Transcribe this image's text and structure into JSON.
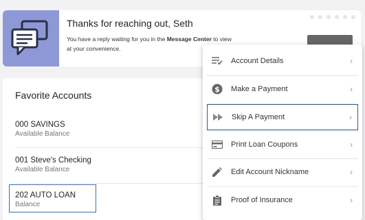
{
  "banner": {
    "title": "Thanks for reaching out, Seth",
    "text_before": "You have a reply waiting for you in the ",
    "text_bold": "Message Center",
    "text_after": " to view at your convenience.",
    "icon": "chat-bubbles-icon",
    "icon_bg_color": "#8f98d6"
  },
  "favorites": {
    "title": "Favorite Accounts",
    "accounts": [
      {
        "name": "000 SAVINGS",
        "sub": "Available Balance"
      },
      {
        "name": "001 Steve's Checking",
        "sub": "Available Balance"
      },
      {
        "name": "202 AUTO LOAN",
        "sub": "Balance"
      }
    ]
  },
  "menu": {
    "items": [
      {
        "label": "Account Details",
        "icon": "list-check-icon"
      },
      {
        "label": "Make a Payment",
        "icon": "dollar-circle-icon"
      },
      {
        "label": "Skip A Payment",
        "icon": "fast-forward-icon"
      },
      {
        "label": "Print Loan Coupons",
        "icon": "card-icon"
      },
      {
        "label": "Edit Account Nickname",
        "icon": "pencil-icon"
      },
      {
        "label": "Proof of Insurance",
        "icon": "clipboard-icon"
      }
    ],
    "chevron": "›"
  }
}
